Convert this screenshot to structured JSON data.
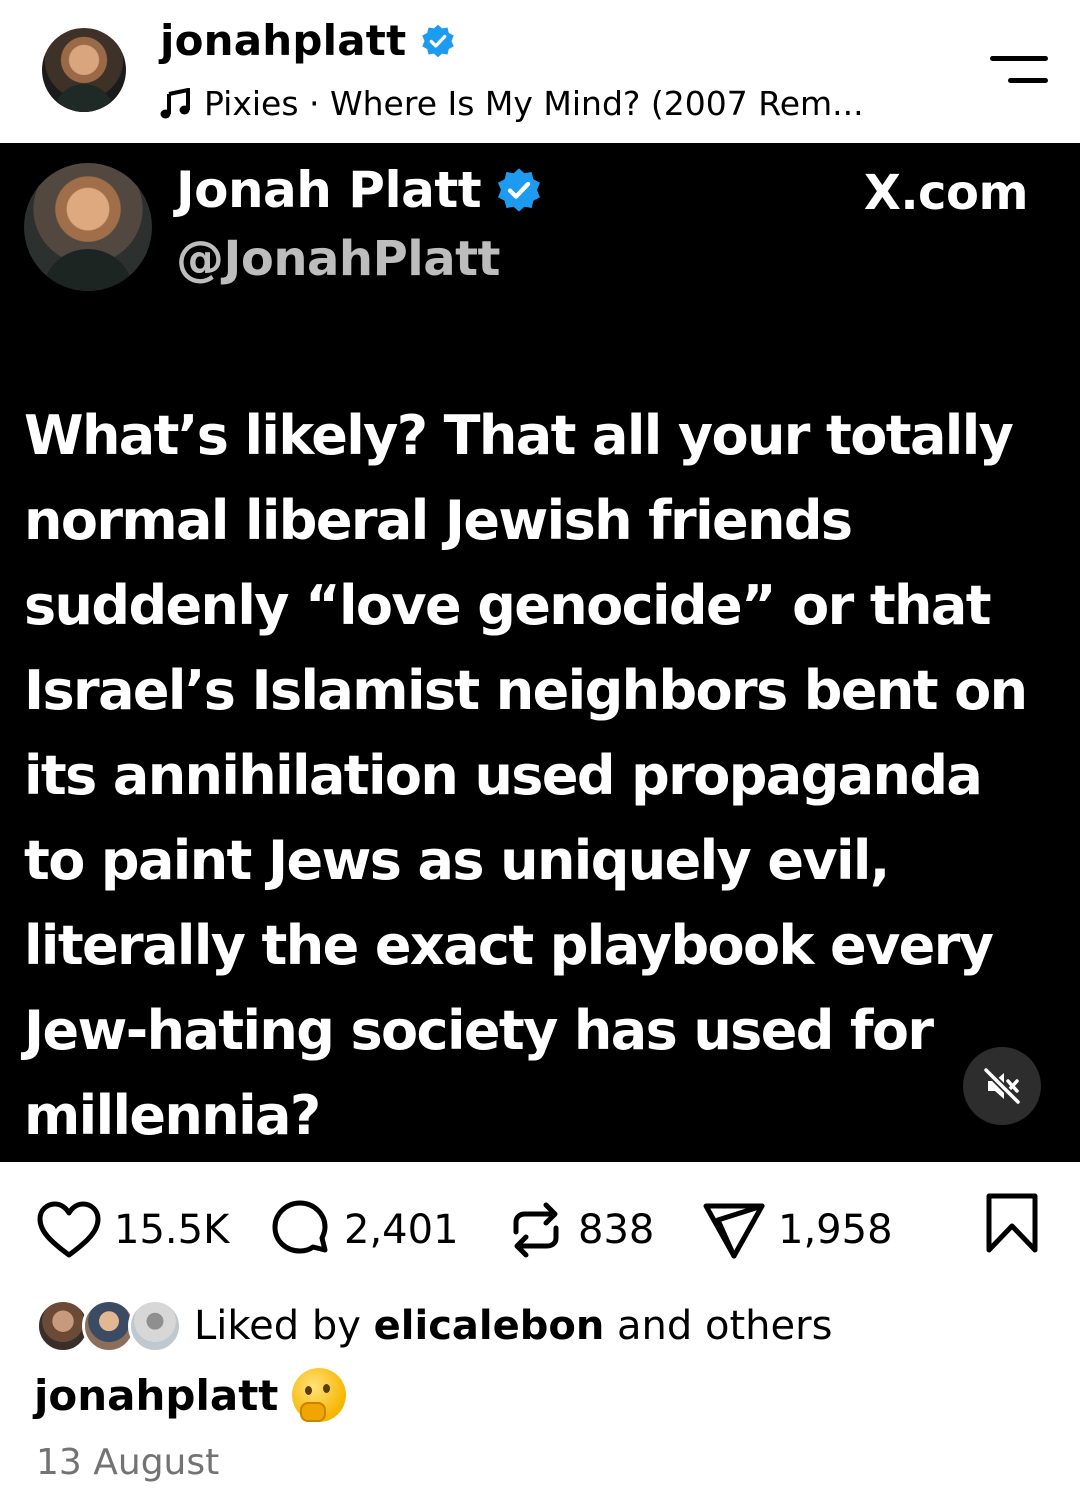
{
  "header": {
    "username": "jonahplatt",
    "music": "Pixies · Where Is My Mind? (2007 Rem..."
  },
  "tweet": {
    "display_name": "Jonah Platt",
    "handle": "@JonahPlatt",
    "source": "X.com",
    "lines": [
      "What’s likely? That all your totally",
      "normal liberal Jewish friends",
      "suddenly “love genocide” or that",
      "Israel’s Islamist neighbors bent on",
      "its annihilation used propaganda",
      "to paint Jews as uniquely evil,",
      "literally the exact playbook every",
      "Jew-hating society has used for",
      "millennia?"
    ]
  },
  "actions": {
    "likes": "15.5K",
    "comments": "2,401",
    "reposts": "838",
    "shares": "1,958"
  },
  "liked_by": {
    "prefix": "Liked by ",
    "user": "elicalebon",
    "suffix": " and others"
  },
  "caption": {
    "username": "jonahplatt"
  },
  "date": "13 August",
  "colors": {
    "verified": "#1d9bf0",
    "tweet_bg": "#000000",
    "secondary_text": "#737373"
  }
}
